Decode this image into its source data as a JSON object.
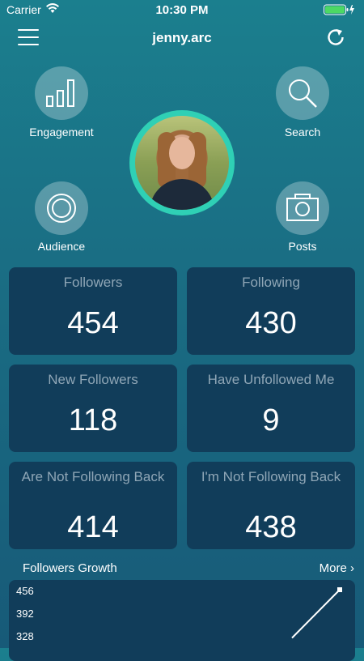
{
  "status": {
    "carrier": "Carrier",
    "time": "10:30 PM"
  },
  "nav": {
    "title": "jenny.arc"
  },
  "actions": {
    "engagement": "Engagement",
    "search": "Search",
    "audience": "Audience",
    "posts": "Posts"
  },
  "stats": [
    {
      "label": "Followers",
      "value": "454"
    },
    {
      "label": "Following",
      "value": "430"
    },
    {
      "label": "New Followers",
      "value": "118"
    },
    {
      "label": "Have Unfollowed Me",
      "value": "9"
    },
    {
      "label": "Are Not Following Back",
      "value": "414"
    },
    {
      "label": "I'm Not Following Back",
      "value": "438"
    }
  ],
  "growth": {
    "title": "Followers Growth",
    "more": "More ›"
  },
  "chart_data": {
    "type": "line",
    "title": "Followers Growth",
    "y_ticks": [
      "456",
      "392",
      "328"
    ],
    "ylim": [
      300,
      470
    ],
    "series": [
      {
        "values": [
          320,
          456
        ]
      }
    ],
    "accent_color": "#ffffff"
  },
  "colors": {
    "accent_ring": "#2fd0b5",
    "card_bg": "#113d5a",
    "label_gray": "#8fa6b6"
  }
}
